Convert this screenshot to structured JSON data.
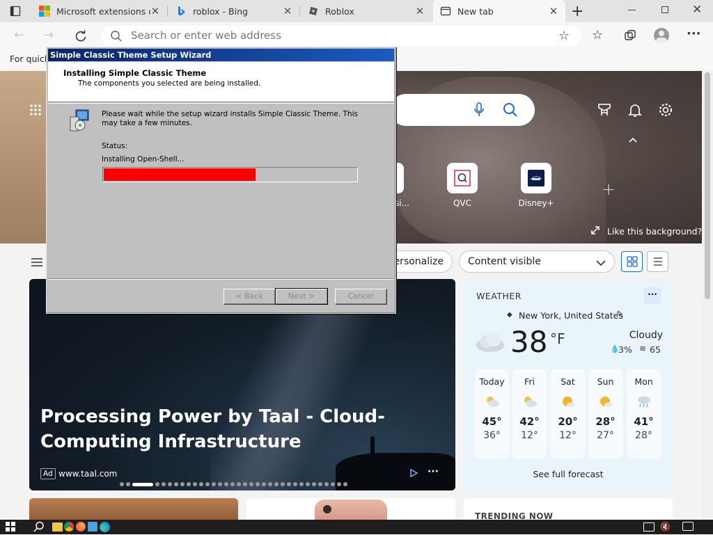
{
  "browser": {
    "tabs": [
      {
        "title": "Microsoft extensions co",
        "icon": "microsoft-logo-icon"
      },
      {
        "title": "roblox - Bing",
        "icon": "bing-icon"
      },
      {
        "title": "Roblox",
        "icon": "roblox-icon"
      },
      {
        "title": "New tab",
        "icon": "new-tab-page-icon",
        "active": true
      }
    ],
    "address_placeholder": "Search or enter web address",
    "favorites_bar_text": "For quick"
  },
  "newtab": {
    "quick_links": [
      {
        "label": "Assi...",
        "icon": "assistant-icon"
      },
      {
        "label": "QVC",
        "icon": "qvc-icon"
      },
      {
        "label": "Disney+",
        "icon": "disney-plus-icon"
      }
    ],
    "like_background": "Like this background?",
    "personalize": "Personalize",
    "content_visible": "Content visible",
    "hero": {
      "title": "Processing Power by Taal - Cloud-Computing Infrastructure",
      "ad_badge": "Ad",
      "source": "www.taal.com",
      "more": "···"
    },
    "weather": {
      "header": "WEATHER",
      "more": "···",
      "location": "New York, United States",
      "temp": "38",
      "unit": "°F",
      "condition": "Cloudy",
      "precip": "3%",
      "aqi": "65",
      "days": [
        {
          "name": "Today",
          "hi": "45°",
          "lo": "36°",
          "icon": "partly-cloudy-icon"
        },
        {
          "name": "Fri",
          "hi": "42°",
          "lo": "12°",
          "icon": "partly-cloudy-icon"
        },
        {
          "name": "Sat",
          "hi": "20°",
          "lo": "12°",
          "icon": "mostly-sunny-icon"
        },
        {
          "name": "Sun",
          "hi": "28°",
          "lo": "27°",
          "icon": "mostly-sunny-icon"
        },
        {
          "name": "Mon",
          "hi": "41°",
          "lo": "28°",
          "icon": "rain-snow-icon"
        }
      ],
      "full_forecast": "See full forecast"
    },
    "trending": "TRENDING NOW"
  },
  "wizard": {
    "title": "Simple Classic Theme Setup Wizard",
    "heading": "Installing Simple Classic Theme",
    "subheading": "The components you selected are being installed.",
    "message": "Please wait while the setup wizard installs Simple Classic Theme. This may take a few minutes.",
    "status_label": "Status:",
    "status_text": "Installing Open-Shell...",
    "progress": 0.6,
    "progress_color": "#ff0000",
    "buttons": {
      "back": "< Back",
      "next": "Next >",
      "cancel": "Cancel"
    }
  }
}
